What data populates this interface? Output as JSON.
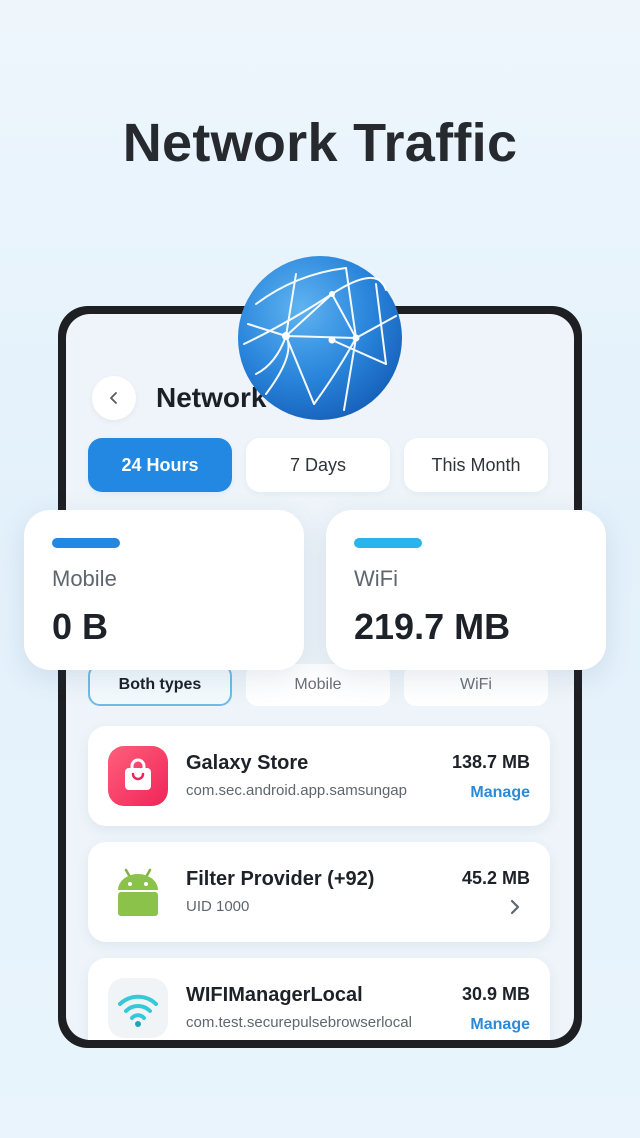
{
  "headline": "Network Traffic",
  "screen": {
    "title": "Network",
    "periods": [
      {
        "label": "24 Hours",
        "active": true
      },
      {
        "label": "7 Days",
        "active": false
      },
      {
        "label": "This Month",
        "active": false
      }
    ],
    "types": [
      {
        "label": "Both types",
        "active": true
      },
      {
        "label": "Mobile",
        "active": false
      },
      {
        "label": "WiFi",
        "active": false
      }
    ],
    "apps": [
      {
        "name": "Galaxy Store",
        "sub": "com.sec.android.app.samsungap",
        "size": "138.7 MB",
        "action": "Manage",
        "icon": "shopping-bag-icon"
      },
      {
        "name": "Filter Provider (+92)",
        "sub": "UID 1000",
        "size": "45.2 MB",
        "action": "",
        "icon": "android-icon"
      },
      {
        "name": "WIFIManagerLocal",
        "sub": "com.test.securepulsebrowserlocal",
        "size": "30.9 MB",
        "action": "Manage",
        "icon": "wifi-icon"
      }
    ]
  },
  "stats": {
    "mobile": {
      "label": "Mobile",
      "value": "0 B",
      "color": "#2388e1"
    },
    "wifi": {
      "label": "WiFi",
      "value": "219.7 MB",
      "color": "#2ab4ec"
    }
  },
  "colors": {
    "accent": "#2388e1",
    "link": "#2c8ad8"
  }
}
